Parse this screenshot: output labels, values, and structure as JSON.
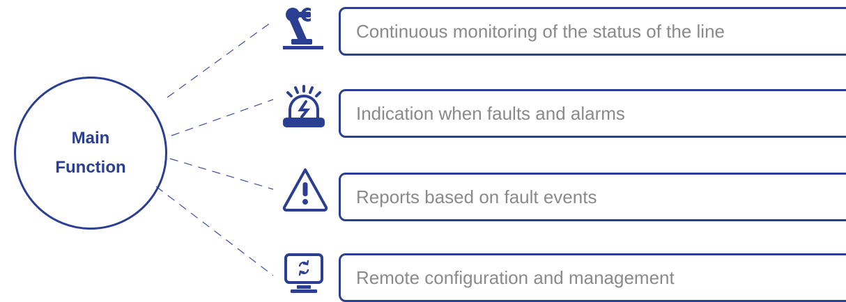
{
  "hub": {
    "line1": "Main",
    "line2": "Function"
  },
  "items": [
    {
      "icon": "robot-arm-icon",
      "text": "Continuous monitoring of the status of the line"
    },
    {
      "icon": "alarm-siren-icon",
      "text": "Indication when faults and alarms"
    },
    {
      "icon": "warning-triangle-icon",
      "text": "Reports based on fault events"
    },
    {
      "icon": "monitor-refresh-icon",
      "text": "Remote configuration and management"
    }
  ],
  "colors": {
    "accent": "#2b3f92",
    "text": "#8a8a8a",
    "connector": "#3a4d9e"
  }
}
